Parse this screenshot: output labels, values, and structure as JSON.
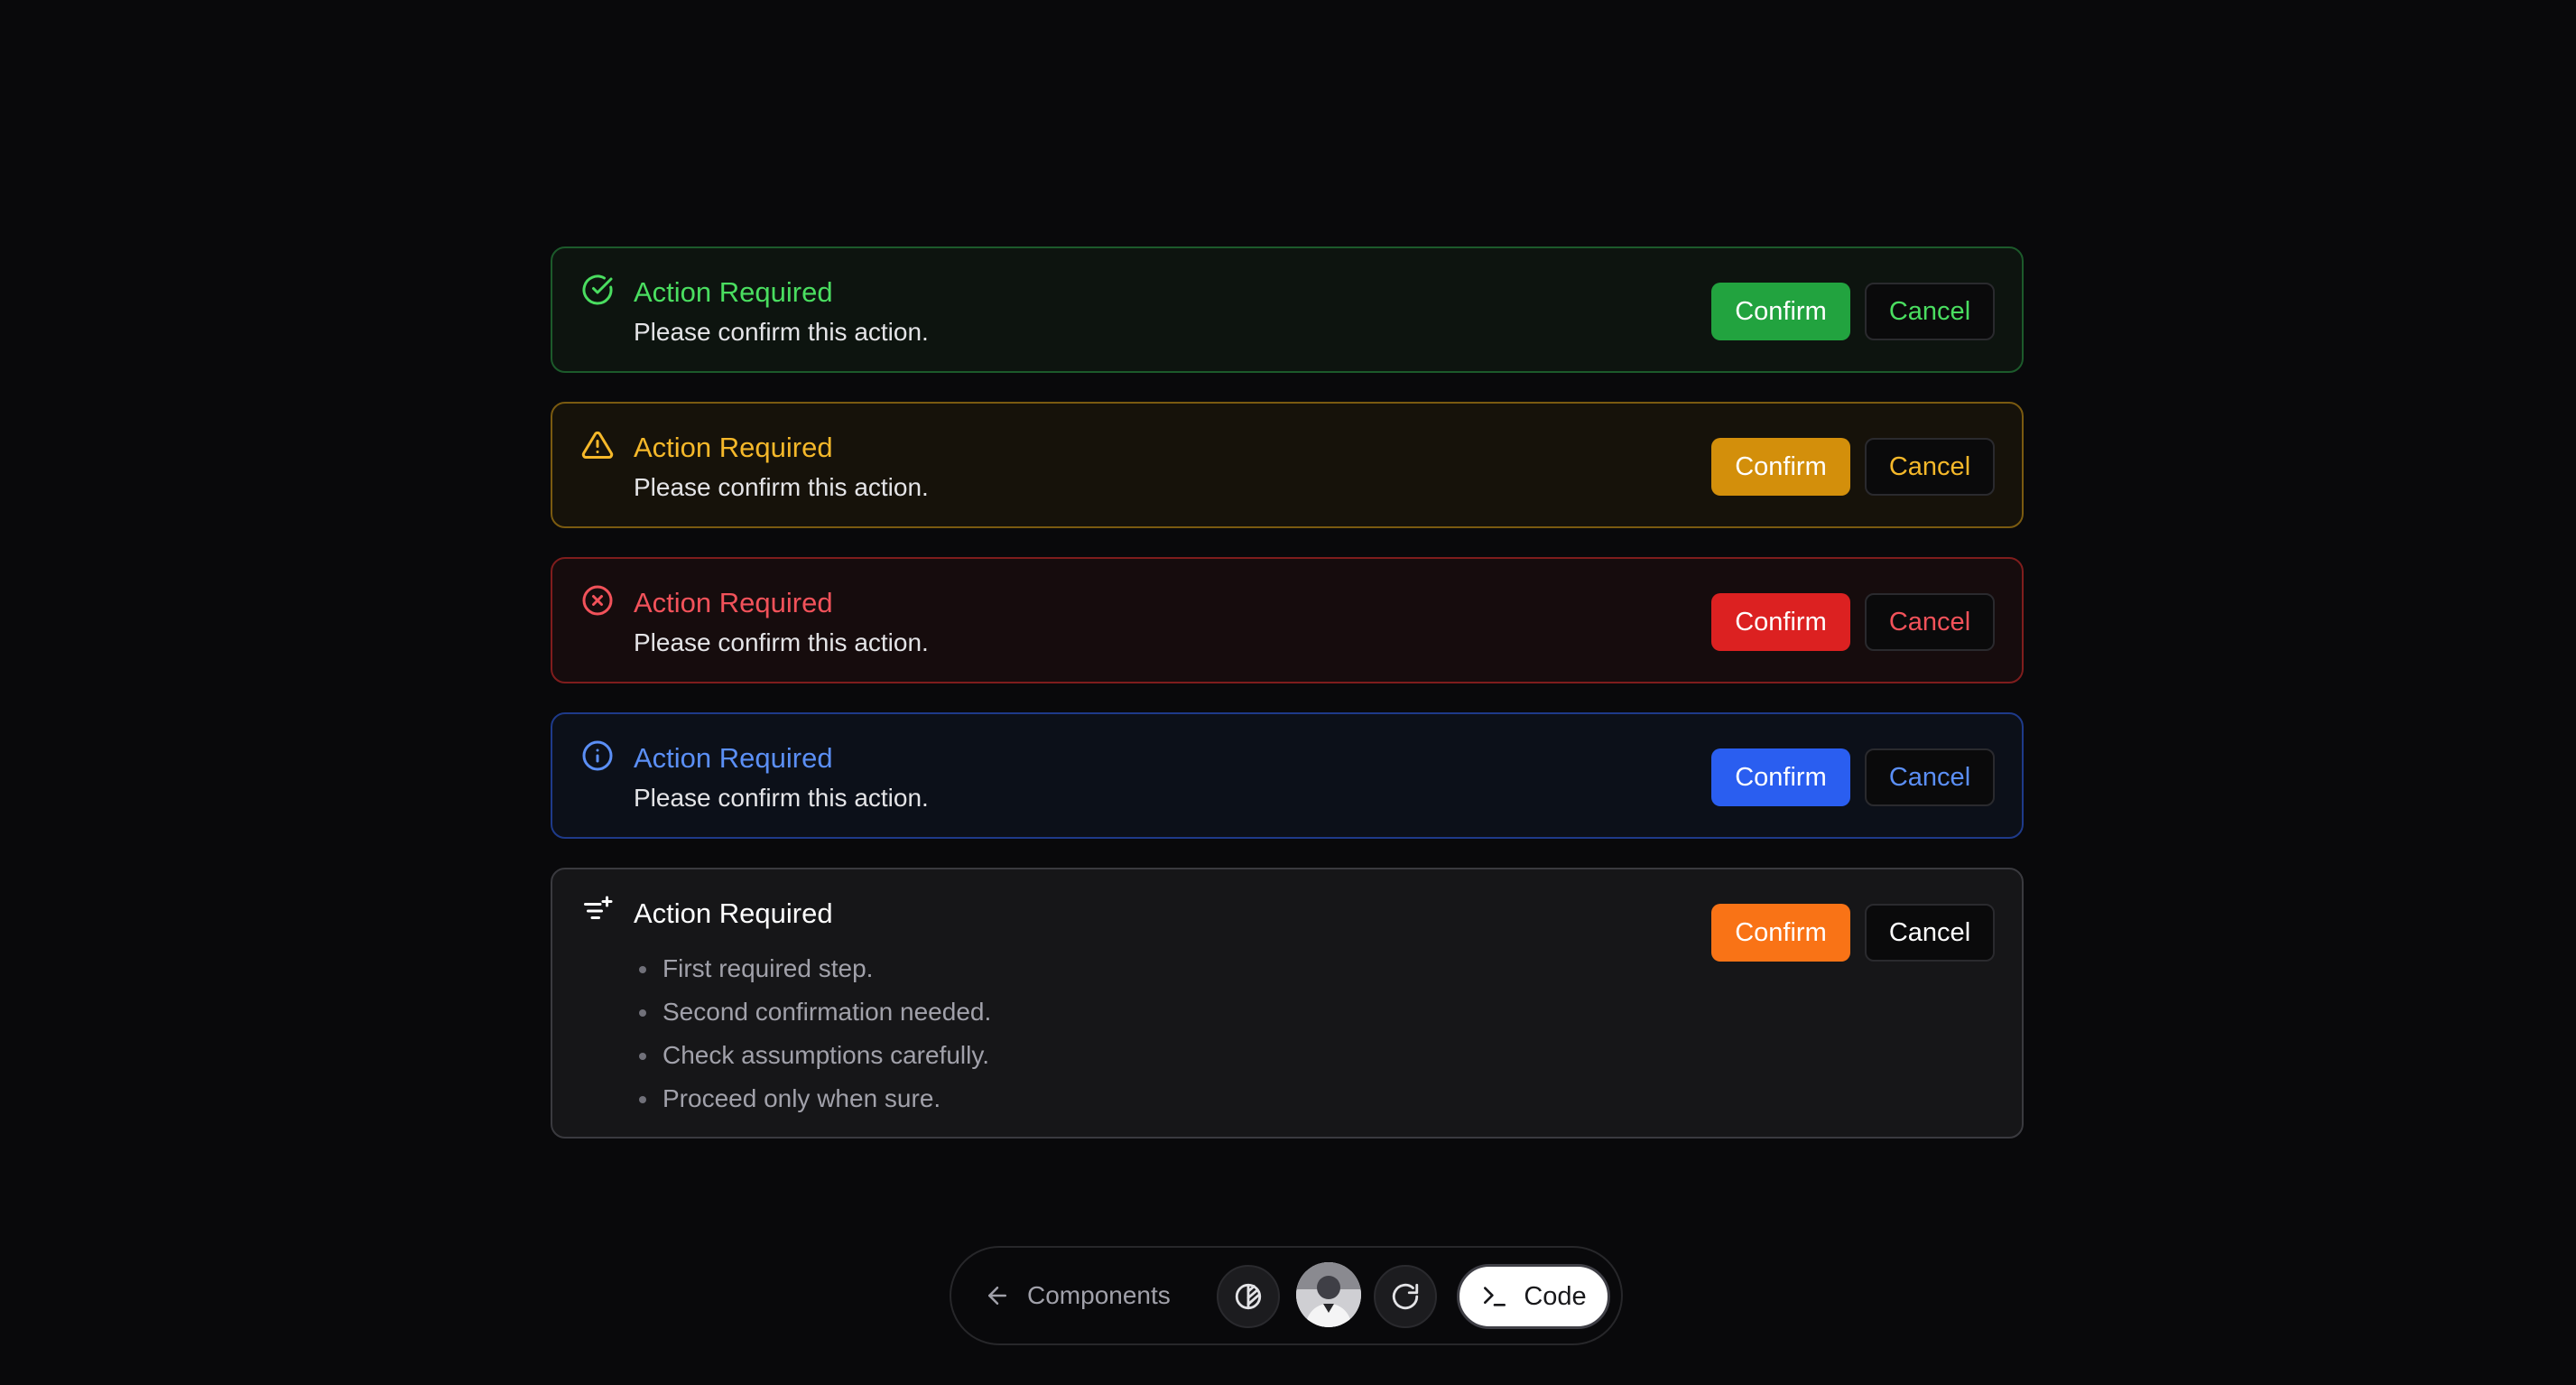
{
  "alerts": [
    {
      "variant": "success",
      "icon": "check-circle-icon",
      "title": "Action Required",
      "description": "Please confirm this action.",
      "confirm_label": "Confirm",
      "cancel_label": "Cancel",
      "accent": "#4ade60"
    },
    {
      "variant": "warning",
      "icon": "warning-triangle-icon",
      "title": "Action Required",
      "description": "Please confirm this action.",
      "confirm_label": "Confirm",
      "cancel_label": "Cancel",
      "accent": "#f5b82a"
    },
    {
      "variant": "error",
      "icon": "x-circle-icon",
      "title": "Action Required",
      "description": "Please confirm this action.",
      "confirm_label": "Confirm",
      "cancel_label": "Cancel",
      "accent": "#f2525a"
    },
    {
      "variant": "info",
      "icon": "info-circle-icon",
      "title": "Action Required",
      "description": "Please confirm this action.",
      "confirm_label": "Confirm",
      "cancel_label": "Cancel",
      "accent": "#5b8ff6"
    },
    {
      "variant": "list",
      "icon": "list-filter-plus-icon",
      "title": "Action Required",
      "steps": [
        "First required step.",
        "Second confirmation needed.",
        "Check assumptions carefully.",
        "Proceed only when sure."
      ],
      "confirm_label": "Confirm",
      "cancel_label": "Cancel",
      "accent": "#f97316"
    }
  ],
  "dock": {
    "back_label": "Components",
    "code_label": "Code",
    "theme_icon": "theme-toggle-icon",
    "refresh_icon": "refresh-icon",
    "avatar": "user-avatar"
  }
}
